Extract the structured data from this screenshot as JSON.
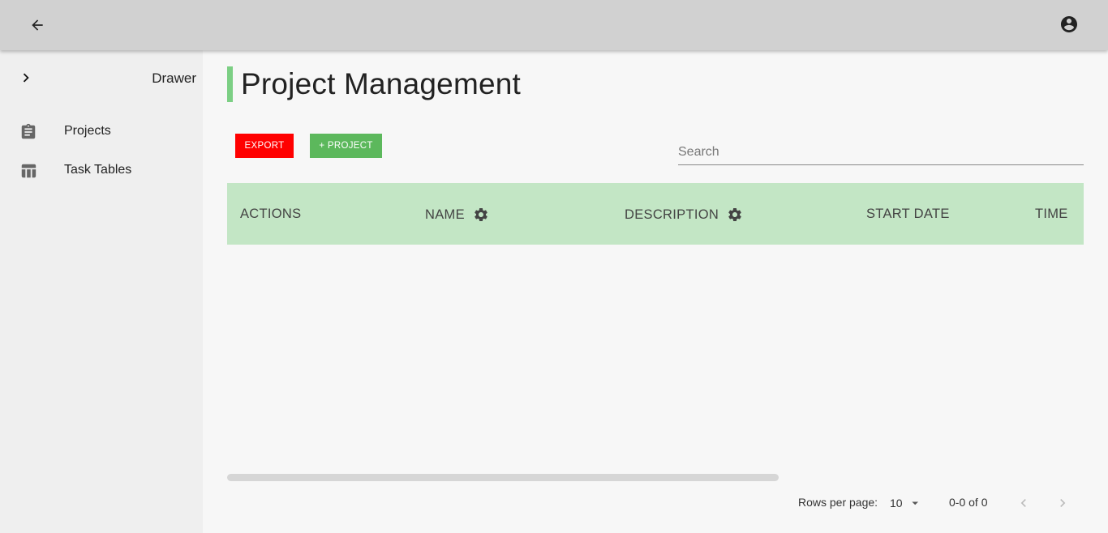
{
  "appbar": {
    "back_icon": "arrow-left-icon",
    "account_icon": "account-circle-icon"
  },
  "drawer": {
    "toggle_icon": "chevron-right-icon",
    "title": "Drawer",
    "items": [
      {
        "label": "Projects",
        "icon": "clipboard-icon"
      },
      {
        "label": "Task Tables",
        "icon": "table-icon"
      }
    ]
  },
  "page": {
    "title": "Project Management",
    "accent_color": "#7ccf84"
  },
  "toolbar": {
    "export_label": "EXPORT",
    "export_color": "#ff0000",
    "add_project_label": "+ PROJECT",
    "add_project_color": "#5cb85c",
    "search_placeholder": "Search",
    "search_value": ""
  },
  "table": {
    "header_color": "#c3e6c5",
    "columns": [
      {
        "label": "ACTIONS",
        "has_settings": false
      },
      {
        "label": "NAME",
        "has_settings": true
      },
      {
        "label": "DESCRIPTION",
        "has_settings": true
      },
      {
        "label": "START DATE",
        "has_settings": false
      },
      {
        "label": "TIME",
        "has_settings": false
      }
    ],
    "rows": []
  },
  "pagination": {
    "rows_per_page_label": "Rows per page:",
    "rows_per_page_value": "10",
    "range_text": "0-0 of 0"
  }
}
